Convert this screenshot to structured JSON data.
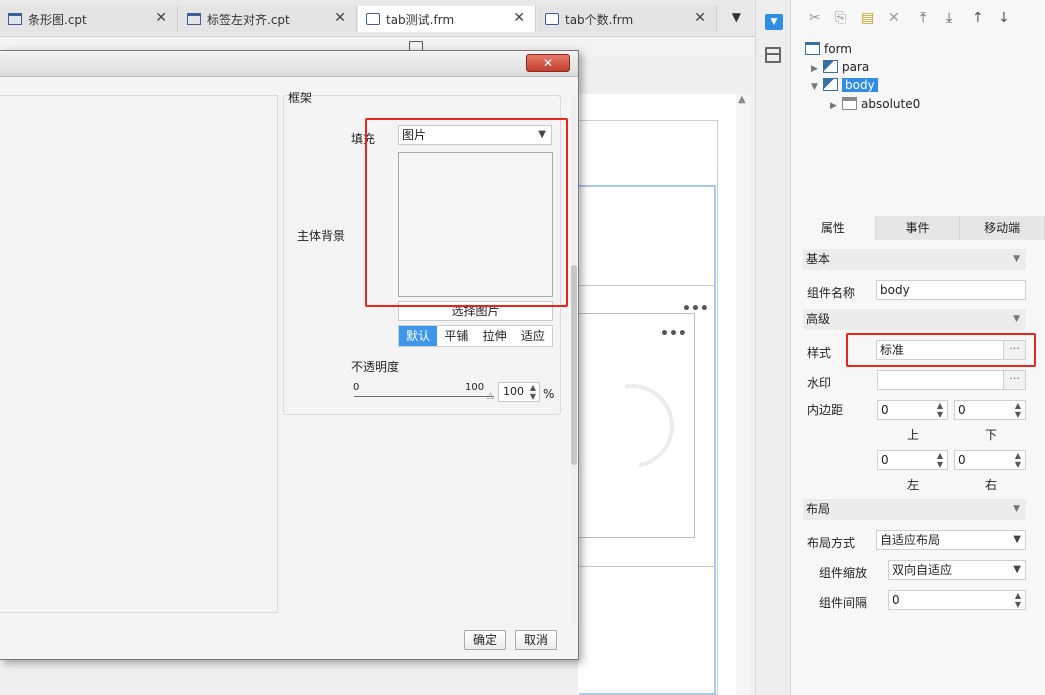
{
  "tabs": [
    {
      "label": "条形图.cpt",
      "close": "✕",
      "icon": "report-icon"
    },
    {
      "label": "标签左对齐.cpt",
      "close": "✕",
      "icon": "report-icon"
    },
    {
      "label": "tab测试.frm",
      "close": "✕",
      "icon": "form-icon"
    },
    {
      "label": "tab个数.frm",
      "close": "✕",
      "icon": "form-icon"
    }
  ],
  "tab_more": "▼",
  "canvas": {
    "dots_a": "•••",
    "dots_b": "•••"
  },
  "dialog": {
    "close": "✕",
    "frame_group": "框架",
    "fill_label": "填充",
    "fill_value": "图片",
    "body_bg_label": "主体背景",
    "choose_image": "选择图片",
    "modes": [
      "默认",
      "平铺",
      "拉伸",
      "适应"
    ],
    "opacity_label": "不透明度",
    "slider_min": "0",
    "slider_max": "100",
    "opacity_value": "100",
    "opacity_unit": "%",
    "ok": "确定",
    "cancel": "取消"
  },
  "tree": {
    "root": "form",
    "para": "para",
    "body": "body",
    "absolute": "absolute0"
  },
  "panel_tabs": [
    "属性",
    "事件",
    "移动端"
  ],
  "props": {
    "basic_section": "基本",
    "name_label": "组件名称",
    "name_value": "body",
    "advanced_section": "高级",
    "style_label": "样式",
    "style_value": "标准",
    "watermark_label": "水印",
    "watermark_value": "",
    "padding_label": "内边距",
    "pad_top": "0",
    "pad_bottom": "0",
    "pad_left": "0",
    "pad_right": "0",
    "top_label": "上",
    "bottom_label": "下",
    "left_label": "左",
    "right_label": "右",
    "layout_section": "布局",
    "layout_mode_label": "布局方式",
    "layout_mode_value": "自适应布局",
    "scale_label": "组件缩放",
    "scale_value": "双向自适应",
    "gap_label": "组件间隔",
    "gap_value": "0",
    "dots": "···"
  },
  "colors": {
    "accent": "#2f8de4",
    "highlight_red": "#e8261d",
    "active_mode": "#3c97ea"
  }
}
